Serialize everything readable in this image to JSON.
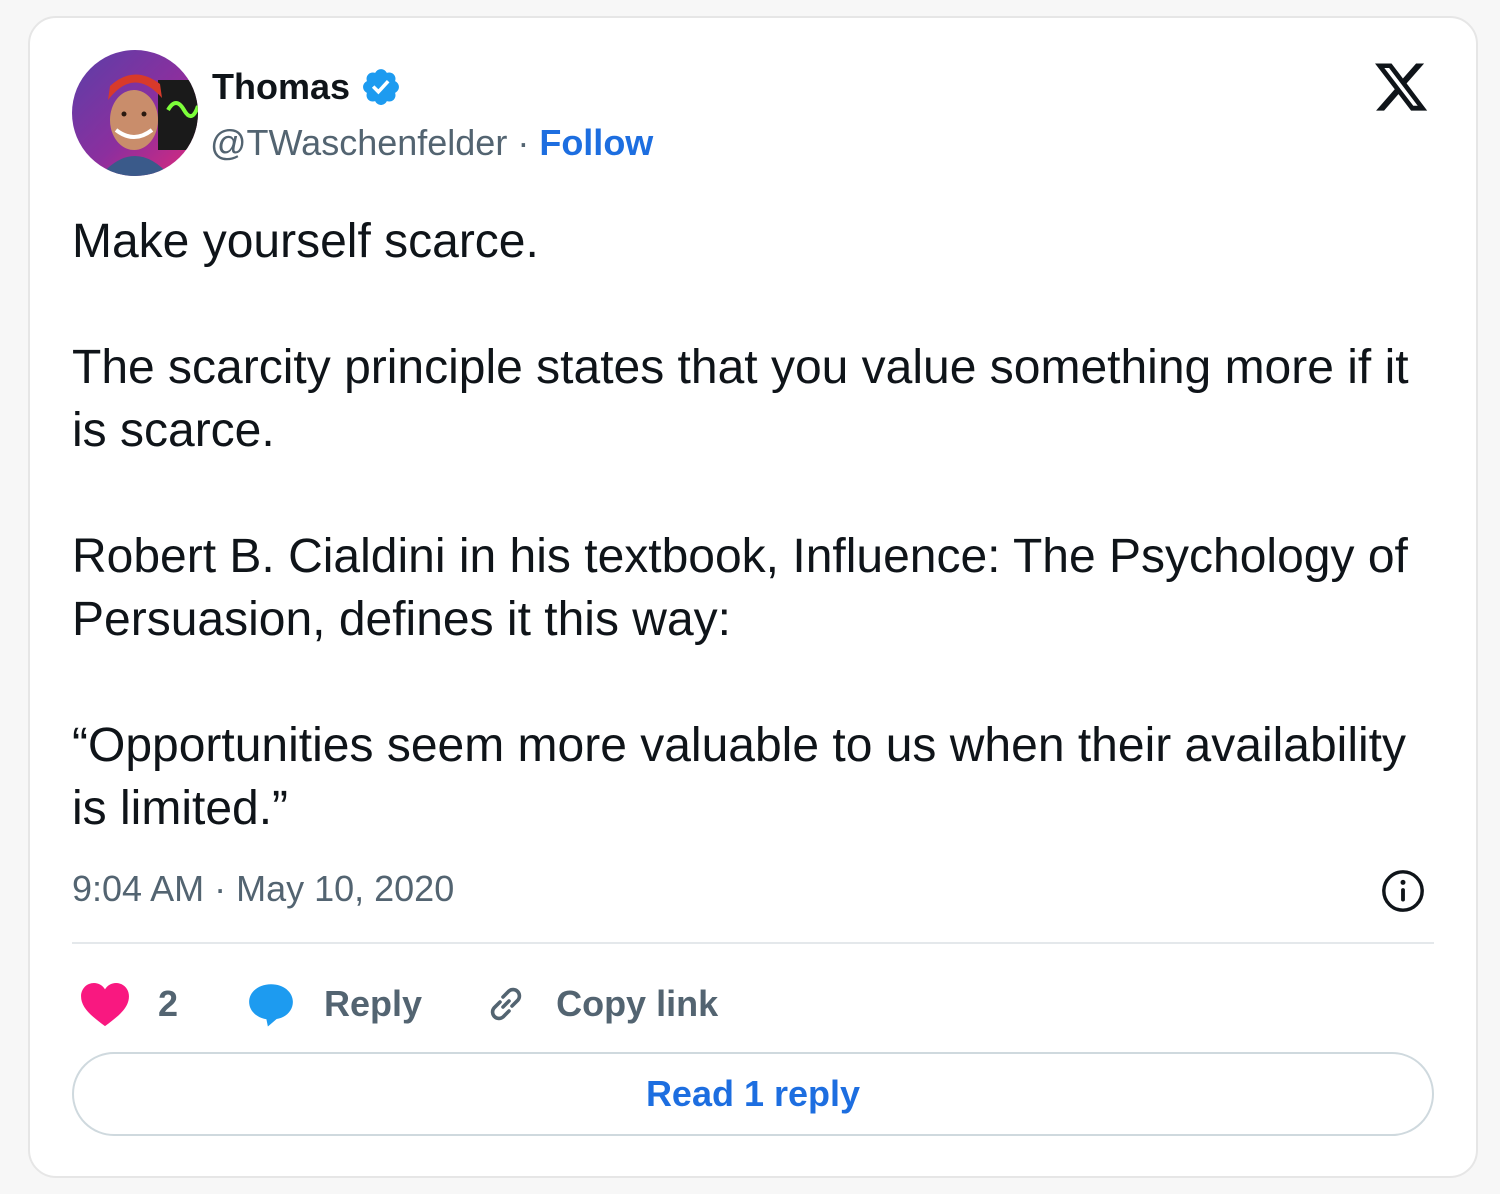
{
  "author": {
    "name": "Thomas",
    "handle": "@TWaschenfelder",
    "separator": "·",
    "follow_label": "Follow",
    "verified": true
  },
  "tweet": {
    "paragraphs": [
      "Make yourself scarce.",
      "The scarcity principle states that you value something more if it is scarce.",
      "Robert B. Cialdini in his textbook, Influence: The Psychology of Persuasion, defines it this way:",
      "“Opportunities seem more valuable to us when their availability is limited.”"
    ],
    "timestamp": "9:04 AM · May 10, 2020"
  },
  "actions": {
    "like_count": "2",
    "reply_label": "Reply",
    "copy_link_label": "Copy link"
  },
  "read_replies_label": "Read 1 reply",
  "icons": {
    "logo": "x-logo-icon",
    "verified": "verified-badge-icon",
    "info": "info-icon",
    "like": "heart-icon",
    "reply": "speech-bubble-icon",
    "copy": "link-icon"
  },
  "colors": {
    "accent": "#1d6ee0",
    "heart": "#f91880",
    "reply_bubble": "#1d9bf0",
    "muted": "#536471",
    "text": "#0f1419"
  }
}
